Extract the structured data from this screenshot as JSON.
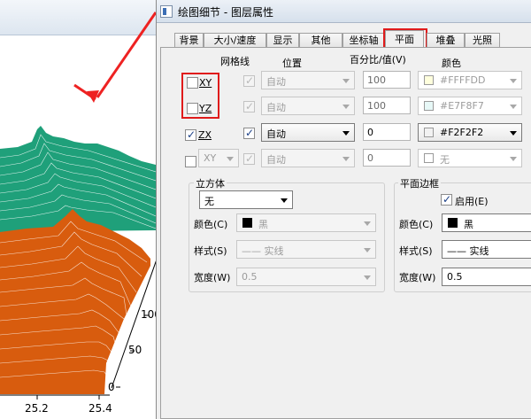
{
  "plot": {
    "y_ticks": [
      "100",
      "50",
      "0"
    ],
    "x_ticks": [
      "25.2",
      "25.4"
    ],
    "colors": {
      "top_surface": "#1fa07a",
      "bottom_surface": "#d85c0e",
      "annotation_arrow": "#ee2222"
    }
  },
  "dialog": {
    "title": "绘图细节 - 图层属性",
    "tabs": [
      {
        "label": "背景",
        "active": false
      },
      {
        "label": "大小/速度",
        "active": false
      },
      {
        "label": "显示",
        "active": false
      },
      {
        "label": "其他",
        "active": false
      },
      {
        "label": "坐标轴",
        "active": false
      },
      {
        "label": "平面",
        "active": true
      },
      {
        "label": "堆叠",
        "active": false
      },
      {
        "label": "光照",
        "active": false
      }
    ],
    "planes": {
      "headers": {
        "grid": "网格线",
        "position": "位置",
        "percent": "百分比/值(V)",
        "color": "颜色"
      },
      "rows": [
        {
          "name": "XY",
          "checked": false,
          "grid_checked": true,
          "position": "自动",
          "value": "100",
          "color_name": "#FFFFDD",
          "color": "#FFFFDD",
          "enabled": false
        },
        {
          "name": "YZ",
          "checked": false,
          "grid_checked": true,
          "position": "自动",
          "value": "100",
          "color_name": "#E7F8F7",
          "color": "#E7F8F7",
          "enabled": false
        },
        {
          "name": "ZX",
          "checked": true,
          "grid_checked": true,
          "position": "自动",
          "value": "0",
          "color_name": "#F2F2F2",
          "color": "#F2F2F2",
          "enabled": true
        },
        {
          "name": "XY",
          "checked": false,
          "grid_checked": true,
          "position": "自动",
          "value": "0",
          "color_name": "无",
          "color": "#ffffff",
          "enabled": false
        }
      ]
    },
    "cube": {
      "title": "立方体",
      "type": "无",
      "color_label": "颜色(C)",
      "color_value": "黑",
      "style_label": "样式(S)",
      "style_value": "—— 实线",
      "width_label": "宽度(W)",
      "width_value": "0.5"
    },
    "plane_border": {
      "title": "平面边框",
      "enable_label": "启用(E)",
      "enabled": true,
      "color_label": "颜色(C)",
      "color_value": "黑",
      "style_label": "样式(S)",
      "style_value": "—— 实线",
      "width_label": "宽度(W)",
      "width_value": "0.5"
    }
  }
}
